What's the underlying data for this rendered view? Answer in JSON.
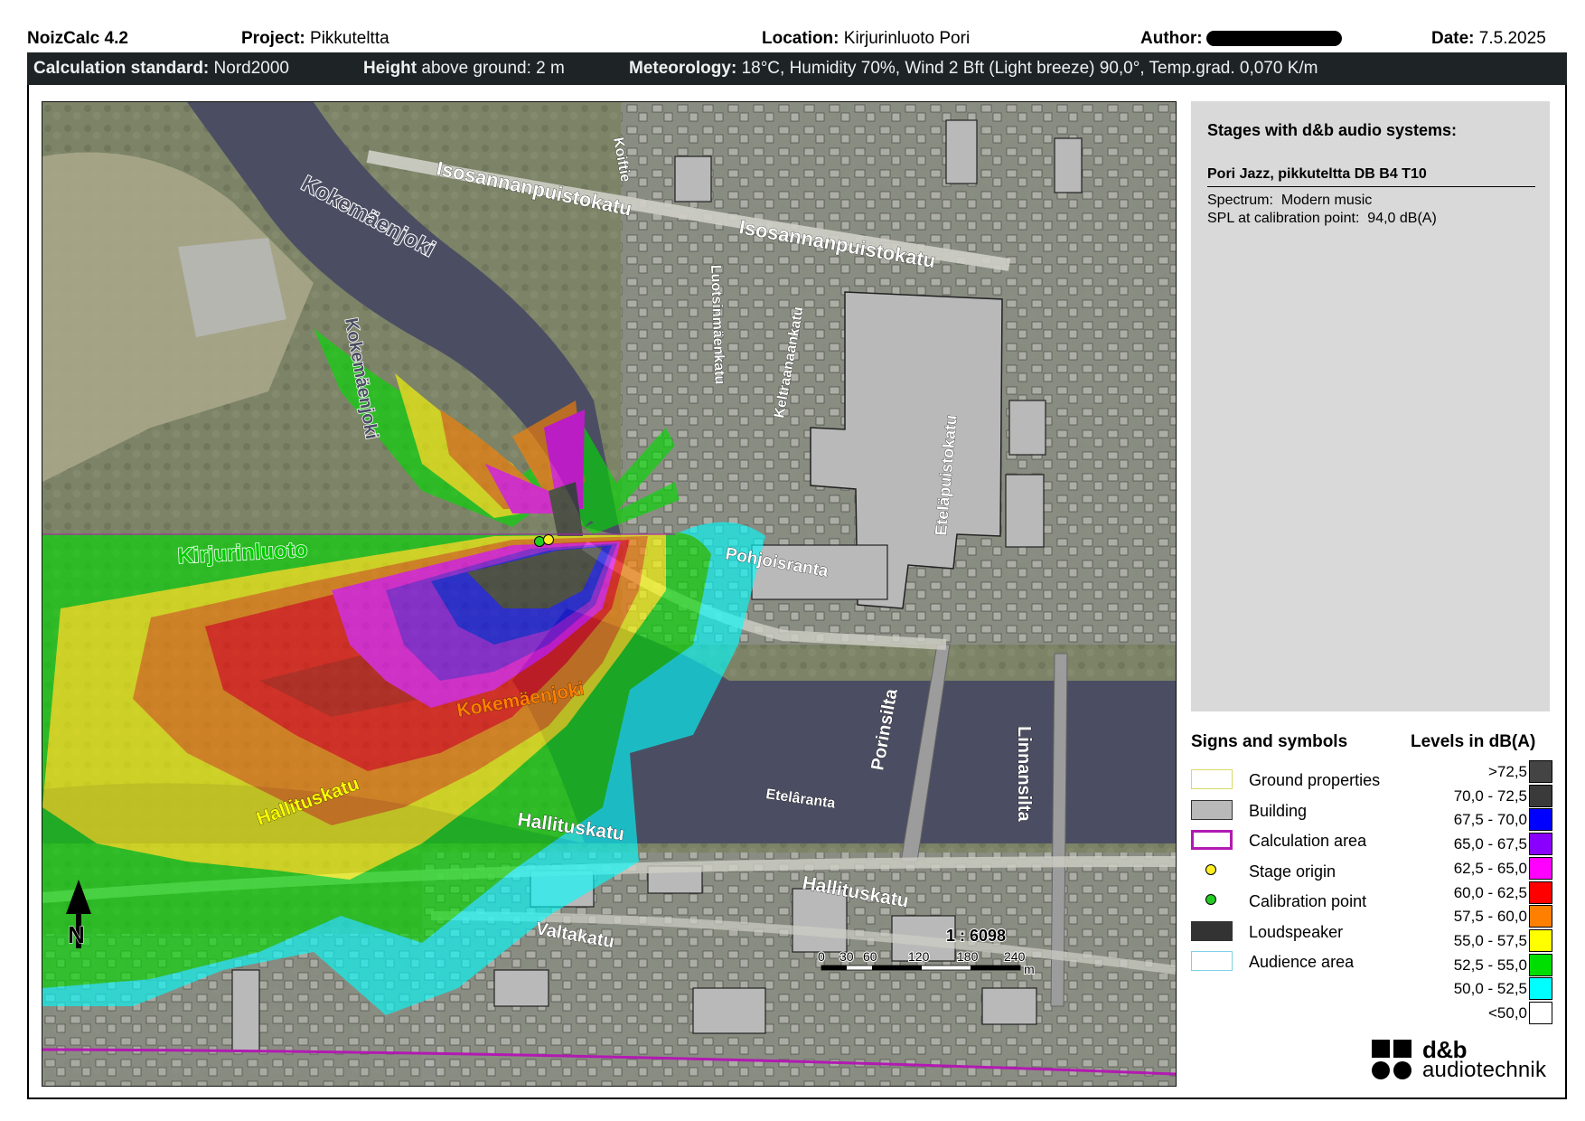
{
  "header": {
    "app": "NoizCalc 4.2",
    "project_label": "Project:",
    "project_value": "Pikkuteltta",
    "location_label": "Location:",
    "location_value": "Kirjurinluoto Pori",
    "author_label": "Author:",
    "date_label": "Date:",
    "date_value": "7.5.2025"
  },
  "calc_bar": {
    "standard_label": "Calculation standard:",
    "standard_value": "Nord2000",
    "height_label": "Height",
    "height_value": "above ground: 2 m",
    "meteo_label": "Meteorology:",
    "meteo_value": "18°C, Humidity 70%, Wind 2 Bft (Light breeze) 90,0°, Temp.grad. 0,070 K/m"
  },
  "stages_panel": {
    "title": "Stages with d&b audio systems:",
    "stage_name": "Pori Jazz, pikkuteltta DB B4 T10",
    "spectrum_label": "Spectrum:",
    "spectrum_value": "Modern music",
    "spl_label": "SPL at calibration point:",
    "spl_value": "94,0 dB(A)"
  },
  "signs": {
    "title": "Signs and symbols",
    "items": [
      {
        "label": "Ground properties",
        "kind": "box",
        "fill": "#ffffff",
        "border": "#d8d86a"
      },
      {
        "label": "Building",
        "kind": "box",
        "fill": "#b9b9b9",
        "border": "#333333"
      },
      {
        "label": "Calculation area",
        "kind": "box",
        "fill": "#ffffff",
        "border": "#b21ab2"
      },
      {
        "label": "Stage origin",
        "kind": "dot",
        "fill": "#ffee22"
      },
      {
        "label": "Calibration point",
        "kind": "dot",
        "fill": "#22cc22"
      },
      {
        "label": "Loudspeaker",
        "kind": "box",
        "fill": "#333333",
        "border": "#333333"
      },
      {
        "label": "Audience area",
        "kind": "box",
        "fill": "#ffffff",
        "border": "#7fd0e8"
      }
    ]
  },
  "levels": {
    "title": "Levels in dB(A)",
    "items": [
      {
        "label": ">72,5",
        "color": "#444444"
      },
      {
        "label": "70,0 - 72,5",
        "color": "#3a3a3a"
      },
      {
        "label": "67,5 - 70,0",
        "color": "#0000ff"
      },
      {
        "label": "65,0 - 67,5",
        "color": "#8a00ff"
      },
      {
        "label": "62,5 - 65,0",
        "color": "#ff00ff"
      },
      {
        "label": "60,0 - 62,5",
        "color": "#ff0000"
      },
      {
        "label": "57,5 - 60,0",
        "color": "#ff8000"
      },
      {
        "label": "55,0 - 57,5",
        "color": "#ffff00"
      },
      {
        "label": "52,5 - 55,0",
        "color": "#00dd00"
      },
      {
        "label": "50,0 - 52,5",
        "color": "#00ffff"
      },
      {
        "label": "<50,0",
        "color": "#ffffff"
      }
    ]
  },
  "map": {
    "scale_ratio": "1 : 6098",
    "scale_ticks": [
      "0",
      "30",
      "60",
      "120",
      "180",
      "240"
    ],
    "scale_unit": "m",
    "north": "N",
    "labels": [
      "Kokemäenjoki",
      "Isosannanpuistokatu",
      "Isosannanpuistokatu",
      "Koiftie",
      "Kirjurinluoto",
      "Kokemäenjoki",
      "Pohjoisranta",
      "Porinsilta",
      "Linnansilta",
      "Etelâranta",
      "Hallituskatu",
      "Hallituskatu",
      "Hallituskatu",
      "Valtakatu",
      "Kokemäenjoki",
      "Luotsinmäenkatu",
      "Keltraanaankatu",
      "Eteläpuistokatu"
    ]
  },
  "logo": {
    "name": "d&b",
    "sub": "audiotechnik"
  }
}
